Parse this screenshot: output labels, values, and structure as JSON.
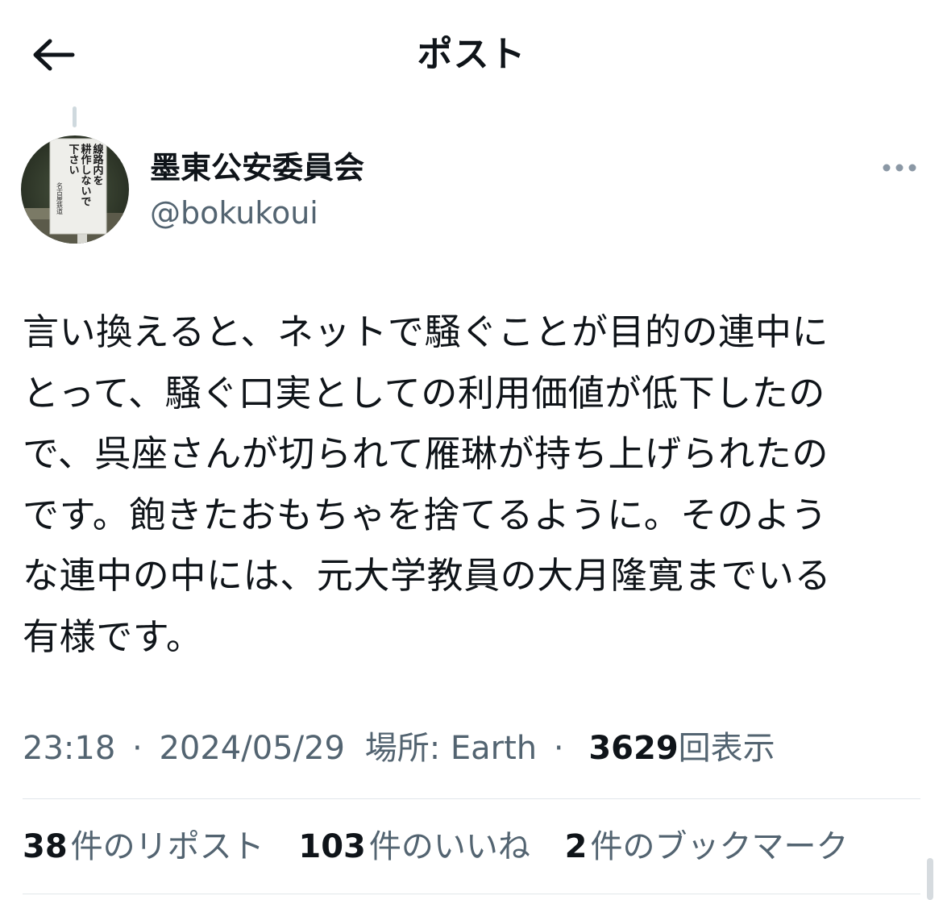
{
  "header": {
    "title": "ポスト",
    "back_icon": "arrow-left-icon"
  },
  "author": {
    "display_name": "墨東公安委員会",
    "handle": "@bokukoui",
    "more_icon": "more-horizontal-icon",
    "avatar": {
      "sign_text_lines": [
        "線路内を",
        "耕作しないで",
        "下さい"
      ],
      "sign_footer": "名古屋鉄道"
    }
  },
  "tweet": {
    "text_lines": [
      "言い換えると、ネットで騒ぐことが目的の連中に",
      "とって、騒ぐ口実としての利用価値が低下したの",
      "で、呉座さんが切られて雁琳が持ち上げられたの",
      "です。飽きたおもちゃを捨てるように。そのよう",
      "な連中の中には、元大学教員の大月隆寛までいる",
      "有様です。"
    ]
  },
  "meta": {
    "time": "23:18",
    "separator": "·",
    "date": "2024/05/29",
    "location": "場所: Earth",
    "views_count": "3629",
    "views_label": "回表示"
  },
  "stats": [
    {
      "count": "38",
      "label": "件のリポスト"
    },
    {
      "count": "103",
      "label": "件のいいね"
    },
    {
      "count": "2",
      "label": "件のブックマーク"
    }
  ],
  "colors": {
    "primary_text": "#0f1419",
    "secondary_text": "#536471",
    "divider": "#e1e6ea"
  }
}
